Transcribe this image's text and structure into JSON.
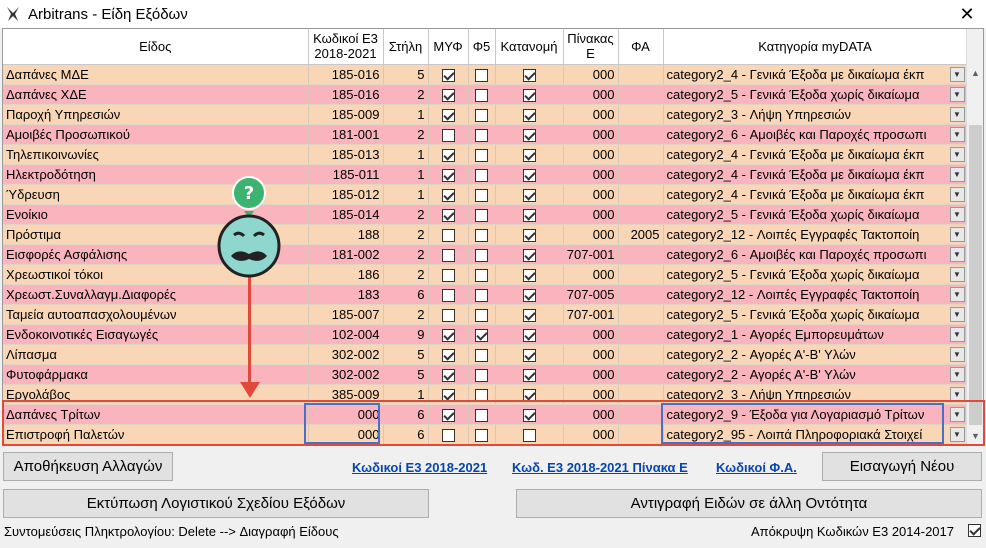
{
  "window": {
    "title": "Arbitrans - Είδη Εξόδων",
    "close_label": "✕"
  },
  "columns": [
    "Είδος",
    "Κωδικοί Ε3\n2018-2021",
    "Στήλη",
    "ΜΥΦ",
    "Φ5",
    "Κατανομή",
    "Πίνακας\nΕ",
    "ΦΑ",
    "Κατηγορία myDATA"
  ],
  "rows": [
    {
      "eidos": "Δαπάνες ΜΔΕ",
      "code": "185-016",
      "stili": "5",
      "myf": true,
      "f5": false,
      "katanomi": true,
      "pinakas": "000",
      "fa": "",
      "category": "category2_4 - Γενικά Έξοδα με δικαίωμα έκπ"
    },
    {
      "eidos": "Δαπάνες ΧΔΕ",
      "code": "185-016",
      "stili": "2",
      "myf": true,
      "f5": false,
      "katanomi": true,
      "pinakas": "000",
      "fa": "",
      "category": "category2_5 - Γενικά Έξοδα χωρίς δικαίωμα"
    },
    {
      "eidos": "Παροχή Υπηρεσιών",
      "code": "185-009",
      "stili": "1",
      "myf": true,
      "f5": false,
      "katanomi": true,
      "pinakas": "000",
      "fa": "",
      "category": "category2_3 - Λήψη Υπηρεσιών"
    },
    {
      "eidos": "Αμοιβές Προσωπικού",
      "code": "181-001",
      "stili": "2",
      "myf": false,
      "f5": false,
      "katanomi": true,
      "pinakas": "000",
      "fa": "",
      "category": "category2_6 - Αμοιβές και Παροχές προσωπι"
    },
    {
      "eidos": "Τηλεπικοινωνίες",
      "code": "185-013",
      "stili": "1",
      "myf": true,
      "f5": false,
      "katanomi": true,
      "pinakas": "000",
      "fa": "",
      "category": "category2_4 - Γενικά Έξοδα με δικαίωμα έκπ"
    },
    {
      "eidos": "Ηλεκτροδότηση",
      "code": "185-011",
      "stili": "1",
      "myf": true,
      "f5": false,
      "katanomi": true,
      "pinakas": "000",
      "fa": "",
      "category": "category2_4 - Γενικά Έξοδα με δικαίωμα έκπ"
    },
    {
      "eidos": "Ύδρευση",
      "code": "185-012",
      "stili": "1",
      "myf": true,
      "f5": false,
      "katanomi": true,
      "pinakas": "000",
      "fa": "",
      "category": "category2_4 - Γενικά Έξοδα με δικαίωμα έκπ"
    },
    {
      "eidos": "Ενοίκιο",
      "code": "185-014",
      "stili": "2",
      "myf": true,
      "f5": false,
      "katanomi": true,
      "pinakas": "000",
      "fa": "",
      "category": "category2_5 - Γενικά Έξοδα χωρίς δικαίωμα"
    },
    {
      "eidos": "Πρόστιμα",
      "code": "188",
      "stili": "2",
      "myf": false,
      "f5": false,
      "katanomi": true,
      "pinakas": "000",
      "fa": "2005",
      "category": "category2_12 - Λοιπές Εγγραφές Τακτοποίη"
    },
    {
      "eidos": "Εισφορές Ασφάλισης",
      "code": "181-002",
      "stili": "2",
      "myf": false,
      "f5": false,
      "katanomi": true,
      "pinakas": "707-001",
      "fa": "",
      "category": "category2_6 - Αμοιβές και Παροχές προσωπι"
    },
    {
      "eidos": "Χρεωστικοί τόκοι",
      "code": "186",
      "stili": "2",
      "myf": false,
      "f5": false,
      "katanomi": true,
      "pinakas": "000",
      "fa": "",
      "category": "category2_5 - Γενικά Έξοδα χωρίς δικαίωμα"
    },
    {
      "eidos": "Χρεωστ.Συναλλαγμ.Διαφορές",
      "code": "183",
      "stili": "6",
      "myf": false,
      "f5": false,
      "katanomi": true,
      "pinakas": "707-005",
      "fa": "",
      "category": "category2_12 - Λοιπές Εγγραφές Τακτοποίη"
    },
    {
      "eidos": "Ταμεία αυτοαπασχολουμένων",
      "code": "185-007",
      "stili": "2",
      "myf": false,
      "f5": false,
      "katanomi": true,
      "pinakas": "707-001",
      "fa": "",
      "category": "category2_5 - Γενικά Έξοδα χωρίς δικαίωμα"
    },
    {
      "eidos": "Ενδοκοινοτικές Εισαγωγές",
      "code": "102-004",
      "stili": "9",
      "myf": true,
      "f5": true,
      "katanomi": true,
      "pinakas": "000",
      "fa": "",
      "category": "category2_1 - Αγορές Εμπορευμάτων"
    },
    {
      "eidos": "Λίπασμα",
      "code": "302-002",
      "stili": "5",
      "myf": true,
      "f5": false,
      "katanomi": true,
      "pinakas": "000",
      "fa": "",
      "category": "category2_2 - Αγορές Α'-Β' Υλών"
    },
    {
      "eidos": "Φυτοφάρμακα",
      "code": "302-002",
      "stili": "5",
      "myf": true,
      "f5": false,
      "katanomi": true,
      "pinakas": "000",
      "fa": "",
      "category": "category2_2 - Αγορές Α'-Β' Υλών"
    },
    {
      "eidos": "Εργολάβος",
      "code": "385-009",
      "stili": "1",
      "myf": true,
      "f5": false,
      "katanomi": true,
      "pinakas": "000",
      "fa": "",
      "category": "category2_3 - Λήψη Υπηρεσιών"
    },
    {
      "eidos": "Δαπάνες Τρίτων",
      "code": "000",
      "stili": "6",
      "myf": true,
      "f5": false,
      "katanomi": true,
      "pinakas": "000",
      "fa": "",
      "category": "category2_9 - Έξοδα για Λογαριασμό Τρίτων"
    },
    {
      "eidos": "Επιστροφή Παλετών",
      "code": "000",
      "stili": "6",
      "myf": false,
      "f5": false,
      "katanomi": false,
      "pinakas": "000",
      "fa": "",
      "category": "category2_95 - Λοιπά Πληροφοριακά Στοιχεί"
    }
  ],
  "buttons": {
    "save": "Αποθήκευση Αλλαγών",
    "new": "Εισαγωγή Νέου",
    "print": "Εκτύπωση Λογιστικού Σχεδίου Εξόδων",
    "copy": "Αντιγραφή Ειδών σε άλλη Οντότητα"
  },
  "links": {
    "codes": "Κωδικοί Ε3 2018-2021",
    "codes_table": "Κωδ. Ε3 2018-2021 Πίνακα Ε",
    "fa_codes": "Κωδικοί Φ.Α."
  },
  "status": {
    "shortcuts": "Συντομεύσεις Πληκτρολογίου: Delete --> Διαγραφή Είδους",
    "hide_codes": "Απόκρυψη Κωδικών Ε3 2014-2017",
    "hide_codes_checked": true
  },
  "mascot": {
    "badge": "?"
  },
  "colors": {
    "row_odd": "#f9d7b6",
    "row_even": "#f9b4bd",
    "highlight_red": "#e04a3a",
    "highlight_blue": "#4a6fc8",
    "link": "#0645ad",
    "mascot": "#8fd6cf",
    "badge": "#3cb371"
  }
}
